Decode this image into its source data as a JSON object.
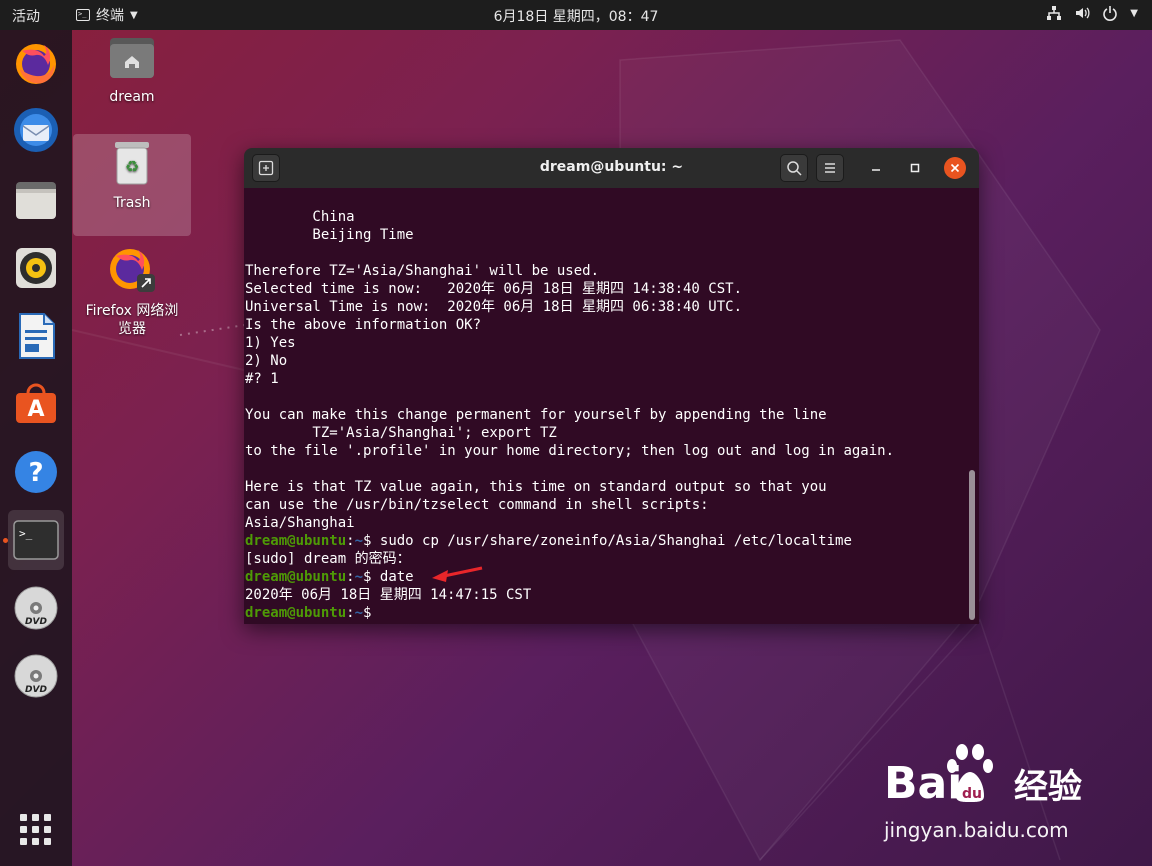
{
  "topbar": {
    "activities": "活动",
    "app_name": "终端",
    "clock": "6月18日 星期四，08：47"
  },
  "dock": {
    "items": [
      {
        "name": "firefox",
        "icon": "firefox-icon"
      },
      {
        "name": "thunderbird",
        "icon": "thunderbird-icon"
      },
      {
        "name": "files",
        "icon": "files-icon"
      },
      {
        "name": "rhythmbox",
        "icon": "rhythmbox-icon"
      },
      {
        "name": "writer",
        "icon": "libreoffice-writer-icon"
      },
      {
        "name": "software",
        "icon": "software-center-icon"
      },
      {
        "name": "help",
        "icon": "help-icon"
      },
      {
        "name": "terminal",
        "icon": "terminal-icon"
      },
      {
        "name": "dvd1",
        "icon": "dvd-icon"
      },
      {
        "name": "dvd2",
        "icon": "dvd-icon"
      }
    ],
    "dvd_label": "DVD"
  },
  "desktop": {
    "home_label": "dream",
    "trash_label": "Trash",
    "firefox_label_line1": "Firefox 网络浏",
    "firefox_label_line2": "览器"
  },
  "terminal": {
    "title": "dream@ubuntu: ~",
    "lines": [
      "        China",
      "        Beijing Time",
      "",
      "Therefore TZ='Asia/Shanghai' will be used.",
      "Selected time is now:   2020年 06月 18日 星期四 14:38:40 CST.",
      "Universal Time is now:  2020年 06月 18日 星期四 06:38:40 UTC.",
      "Is the above information OK?",
      "1) Yes",
      "2) No",
      "#? 1",
      "",
      "You can make this change permanent for yourself by appending the line",
      "        TZ='Asia/Shanghai'; export TZ",
      "to the file '.profile' in your home directory; then log out and log in again.",
      "",
      "Here is that TZ value again, this time on standard output so that you",
      "can use the /usr/bin/tzselect command in shell scripts:",
      "Asia/Shanghai"
    ],
    "prompt_user": "dream@ubuntu",
    "prompt_sep": ":",
    "prompt_path": "~",
    "prompt_sym": "$ ",
    "cmd1": "sudo cp /usr/share/zoneinfo/Asia/Shanghai /etc/localtime",
    "sudo_prompt": "[sudo] dream 的密码：",
    "cmd2": "date",
    "date_output": "2020年 06月 18日 星期四 14:47:15 CST"
  },
  "watermark": {
    "text": "jingyan.baidu.com",
    "brand": "经验"
  },
  "colors": {
    "terminal_bg": "#300a24",
    "prompt_user": "#4e9a06",
    "prompt_path": "#3465a4",
    "accent": "#e95420"
  }
}
